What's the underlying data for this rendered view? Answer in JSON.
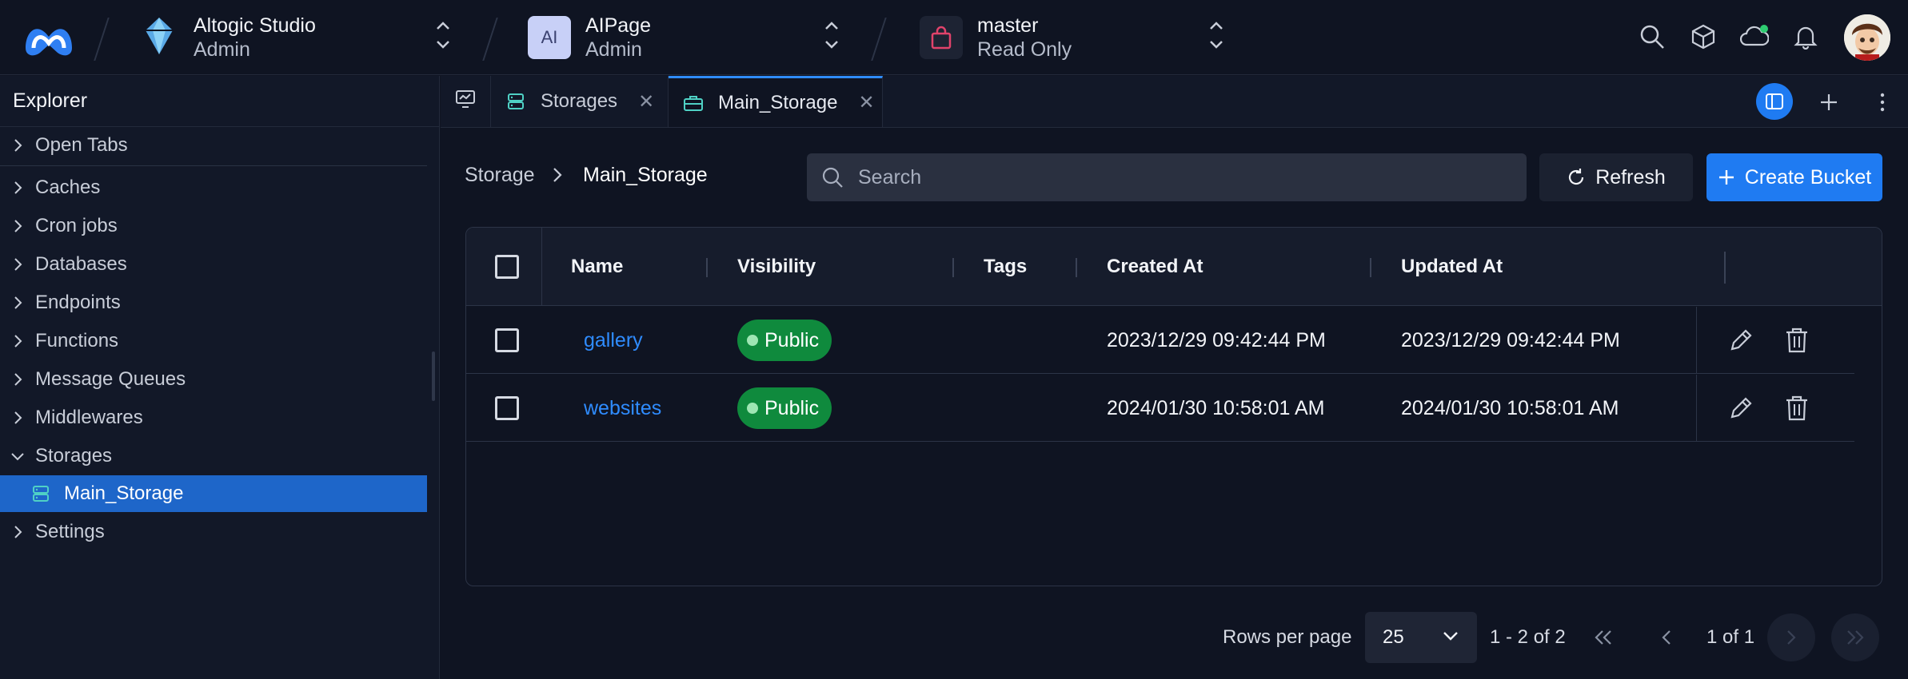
{
  "topbar": {
    "org": {
      "title": "Altogic Studio",
      "role": "Admin"
    },
    "app": {
      "badge": "AI",
      "title": "AIPage",
      "role": "Admin"
    },
    "env": {
      "title": "master",
      "role": "Read Only"
    },
    "icons": [
      "search-icon",
      "package-icon",
      "cloud-status-icon",
      "bell-icon"
    ],
    "status_color": "#2ecc71"
  },
  "sidebar": {
    "header": "Explorer",
    "items": [
      {
        "label": "Open Tabs"
      },
      {
        "label": "Caches"
      },
      {
        "label": "Cron jobs"
      },
      {
        "label": "Databases"
      },
      {
        "label": "Endpoints"
      },
      {
        "label": "Functions"
      },
      {
        "label": "Message Queues"
      },
      {
        "label": "Middlewares"
      },
      {
        "label": "Storages",
        "expanded": true
      },
      {
        "label": "Main_Storage",
        "selected": true
      },
      {
        "label": "Settings"
      }
    ]
  },
  "tabs": [
    {
      "label": "Storages"
    },
    {
      "label": "Main_Storage",
      "active": true
    }
  ],
  "breadcrumb": {
    "root": "Storage",
    "current": "Main_Storage"
  },
  "search": {
    "placeholder": "Search",
    "value": ""
  },
  "actions": {
    "refresh": "Refresh",
    "create": "Create Bucket"
  },
  "table": {
    "columns": [
      "Name",
      "Visibility",
      "Tags",
      "Created At",
      "Updated At"
    ],
    "rows": [
      {
        "name": "gallery",
        "visibility": "Public",
        "tags": "",
        "created": "2023/12/29 09:42:44 PM",
        "updated": "2023/12/29 09:42:44 PM"
      },
      {
        "name": "websites",
        "visibility": "Public",
        "tags": "",
        "created": "2024/01/30 10:58:01 AM",
        "updated": "2024/01/30 10:58:01 AM"
      }
    ]
  },
  "pagination": {
    "rows_label": "Rows per page",
    "rows_value": "25",
    "range": "1 - 2 of 2",
    "page": "1 of 1"
  },
  "colors": {
    "accent": "#1f7bf2",
    "link": "#2f8cff",
    "public_badge": "#0f8a3d",
    "selected_item": "#1e66c9"
  }
}
